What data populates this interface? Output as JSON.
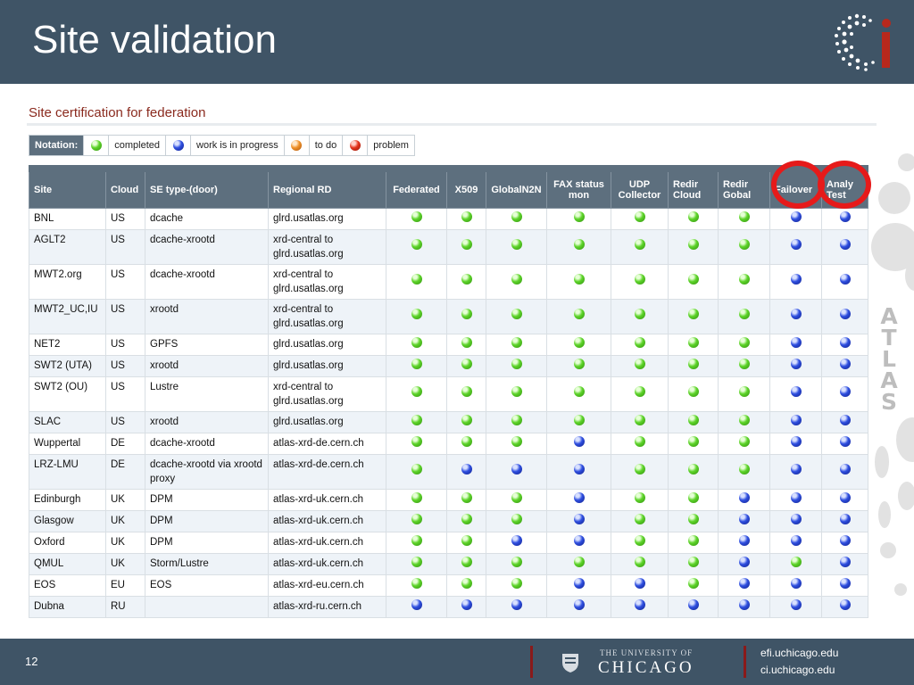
{
  "slide": {
    "title": "Site validation",
    "page_number": "12"
  },
  "section_title": "Site certification for federation",
  "legend": {
    "label": "Notation:",
    "items": [
      {
        "status": "completed",
        "label": "completed"
      },
      {
        "status": "progress",
        "label": "work is in progress"
      },
      {
        "status": "todo",
        "label": "to do"
      },
      {
        "status": "problem",
        "label": "problem"
      }
    ]
  },
  "status_colors": {
    "completed": "#5ed42a",
    "progress": "#2f4fe0",
    "todo": "#f0922a",
    "problem": "#e6351c"
  },
  "table": {
    "columns": [
      "Site",
      "Cloud",
      "SE type-(door)",
      "Regional RD",
      "Federated",
      "X509",
      "GlobalN2N",
      "FAX status mon",
      "UDP Collector",
      "Redir Cloud",
      "Redir Gobal",
      "Failover",
      "Analy Test"
    ],
    "rows": [
      {
        "site": "BNL",
        "cloud": "US",
        "se_type": "dcache",
        "rd": "glrd.usatlas.org",
        "status": [
          "completed",
          "completed",
          "completed",
          "completed",
          "completed",
          "completed",
          "completed",
          "progress",
          "progress"
        ]
      },
      {
        "site": "AGLT2",
        "cloud": "US",
        "se_type": "dcache-xrootd",
        "rd": "xrd-central to glrd.usatlas.org",
        "status": [
          "completed",
          "completed",
          "completed",
          "completed",
          "completed",
          "completed",
          "completed",
          "progress",
          "progress"
        ]
      },
      {
        "site": "MWT2.org",
        "cloud": "US",
        "se_type": "dcache-xrootd",
        "rd": "xrd-central to glrd.usatlas.org",
        "status": [
          "completed",
          "completed",
          "completed",
          "completed",
          "completed",
          "completed",
          "completed",
          "progress",
          "progress"
        ]
      },
      {
        "site": "MWT2_UC,IU",
        "cloud": "US",
        "se_type": "xrootd",
        "rd": "xrd-central to glrd.usatlas.org",
        "status": [
          "completed",
          "completed",
          "completed",
          "completed",
          "completed",
          "completed",
          "completed",
          "progress",
          "progress"
        ]
      },
      {
        "site": "NET2",
        "cloud": "US",
        "se_type": "GPFS",
        "rd": "glrd.usatlas.org",
        "status": [
          "completed",
          "completed",
          "completed",
          "completed",
          "completed",
          "completed",
          "completed",
          "progress",
          "progress"
        ]
      },
      {
        "site": "SWT2 (UTA)",
        "cloud": "US",
        "se_type": "xrootd",
        "rd": "glrd.usatlas.org",
        "status": [
          "completed",
          "completed",
          "completed",
          "completed",
          "completed",
          "completed",
          "completed",
          "progress",
          "progress"
        ]
      },
      {
        "site": "SWT2 (OU)",
        "cloud": "US",
        "se_type": "Lustre",
        "rd": "xrd-central to glrd.usatlas.org",
        "status": [
          "completed",
          "completed",
          "completed",
          "completed",
          "completed",
          "completed",
          "completed",
          "progress",
          "progress"
        ]
      },
      {
        "site": "SLAC",
        "cloud": "US",
        "se_type": "xrootd",
        "rd": "glrd.usatlas.org",
        "status": [
          "completed",
          "completed",
          "completed",
          "completed",
          "completed",
          "completed",
          "completed",
          "progress",
          "progress"
        ]
      },
      {
        "site": "Wuppertal",
        "cloud": "DE",
        "se_type": "dcache-xrootd",
        "rd": "atlas-xrd-de.cern.ch",
        "status": [
          "completed",
          "completed",
          "completed",
          "progress",
          "completed",
          "completed",
          "completed",
          "progress",
          "progress"
        ]
      },
      {
        "site": "LRZ-LMU",
        "cloud": "DE",
        "se_type": "dcache-xrootd via xrootd proxy",
        "rd": "atlas-xrd-de.cern.ch",
        "status": [
          "completed",
          "progress",
          "progress",
          "progress",
          "completed",
          "completed",
          "completed",
          "progress",
          "progress"
        ]
      },
      {
        "site": "Edinburgh",
        "cloud": "UK",
        "se_type": "DPM",
        "rd": "atlas-xrd-uk.cern.ch",
        "status": [
          "completed",
          "completed",
          "completed",
          "progress",
          "completed",
          "completed",
          "progress",
          "progress",
          "progress"
        ]
      },
      {
        "site": "Glasgow",
        "cloud": "UK",
        "se_type": "DPM",
        "rd": "atlas-xrd-uk.cern.ch",
        "status": [
          "completed",
          "completed",
          "completed",
          "progress",
          "completed",
          "completed",
          "progress",
          "progress",
          "progress"
        ]
      },
      {
        "site": "Oxford",
        "cloud": "UK",
        "se_type": "DPM",
        "rd": "atlas-xrd-uk.cern.ch",
        "status": [
          "completed",
          "completed",
          "progress",
          "progress",
          "completed",
          "completed",
          "progress",
          "progress",
          "progress"
        ]
      },
      {
        "site": "QMUL",
        "cloud": "UK",
        "se_type": "Storm/Lustre",
        "rd": "atlas-xrd-uk.cern.ch",
        "status": [
          "completed",
          "completed",
          "completed",
          "completed",
          "completed",
          "completed",
          "progress",
          "completed",
          "progress"
        ]
      },
      {
        "site": "EOS",
        "cloud": "EU",
        "se_type": "EOS",
        "rd": "atlas-xrd-eu.cern.ch",
        "status": [
          "completed",
          "completed",
          "completed",
          "progress",
          "progress",
          "completed",
          "progress",
          "progress",
          "progress"
        ]
      },
      {
        "site": "Dubna",
        "cloud": "RU",
        "se_type": "",
        "rd": "atlas-xrd-ru.cern.ch",
        "status": [
          "progress",
          "progress",
          "progress",
          "progress",
          "progress",
          "progress",
          "progress",
          "progress",
          "progress"
        ]
      }
    ]
  },
  "atlas_logo": [
    "A",
    "T",
    "L",
    "A",
    "S"
  ],
  "uc_logo": {
    "small": "THE UNIVERSITY OF",
    "big": "CHICAGO"
  },
  "footer": {
    "url1": "efi.uchicago.edu",
    "url2": "ci.uchicago.edu"
  }
}
